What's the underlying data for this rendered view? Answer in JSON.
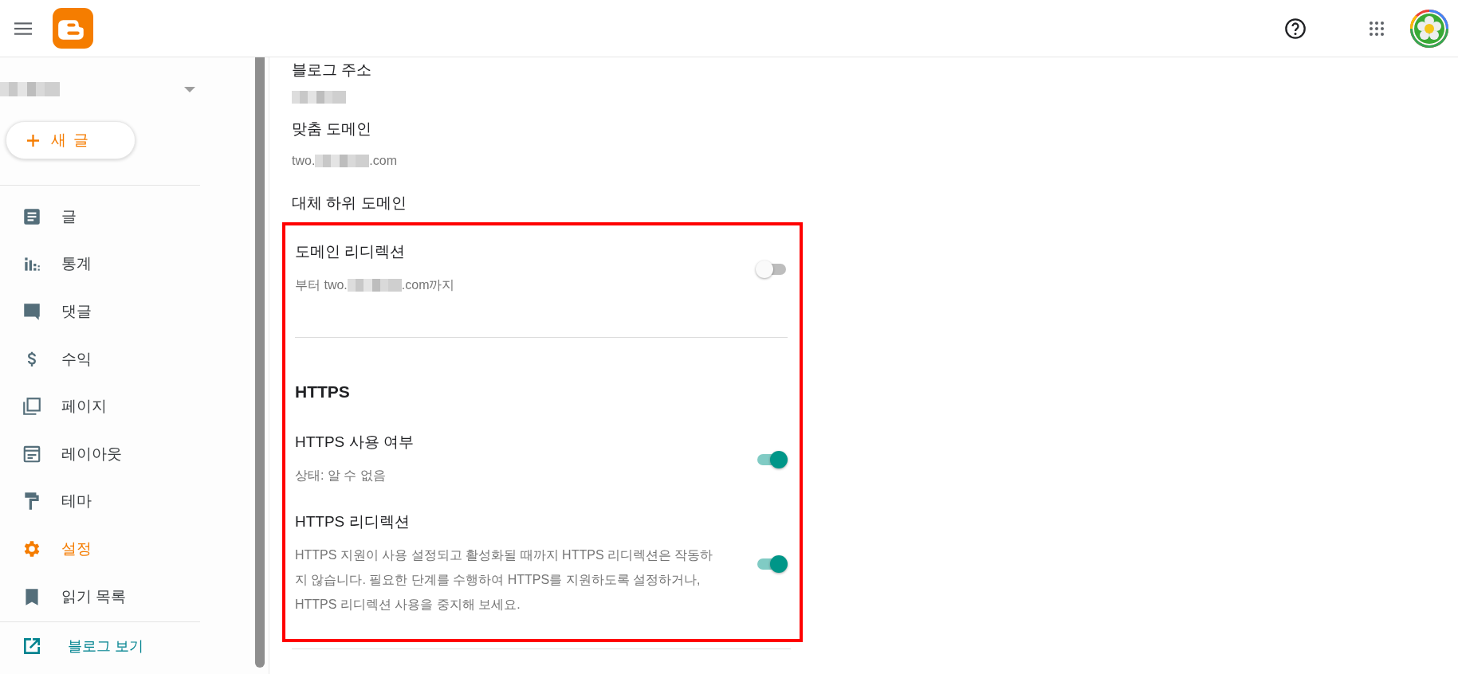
{
  "sidebar": {
    "new_post_button": {
      "label": "새 글"
    },
    "nav_items": [
      {
        "label": "글",
        "selected": false
      },
      {
        "label": "통계",
        "selected": false
      },
      {
        "label": "댓글",
        "selected": false
      },
      {
        "label": "수익",
        "selected": false
      },
      {
        "label": "페이지",
        "selected": false
      },
      {
        "label": "레이아웃",
        "selected": false
      },
      {
        "label": "테마",
        "selected": false
      },
      {
        "label": "설정",
        "selected": true
      },
      {
        "label": "읽기 목록",
        "selected": false
      }
    ],
    "view_blog_link": {
      "label": "블로그 보기"
    }
  },
  "fields": [
    {
      "title": "블로그 주소",
      "value_parts": [
        {
          "kind": "redacted"
        }
      ]
    },
    {
      "title": "맞춤 도메인",
      "value_parts": [
        {
          "kind": "text",
          "text": "two."
        },
        {
          "kind": "redacted"
        },
        {
          "kind": "text",
          "text": ".com"
        }
      ]
    },
    {
      "title": "대체 하위 도메인"
    }
  ],
  "highlighted_sections": [
    {
      "toggles": [
        {
          "title": "도메인 리디렉션",
          "description_parts": [
            {
              "kind": "text",
              "text": "부터 two."
            },
            {
              "kind": "redacted"
            },
            {
              "kind": "text",
              "text": ".com까지"
            }
          ],
          "on": false
        }
      ]
    },
    {
      "heading": "HTTPS",
      "toggles": [
        {
          "title": "HTTPS 사용 여부",
          "description_parts": [
            {
              "kind": "text",
              "text": "상태: 알 수 없음"
            }
          ],
          "on": true
        },
        {
          "title": "HTTPS 리디렉션",
          "description_parts": [
            {
              "kind": "text",
              "text": "HTTPS 지원이 사용 설정되고 활성화될 때까지 HTTPS 리디렉션은 작동하지 않습니다. 필요한 단계를 수행하여 HTTPS를 지원하도록 설정하거나, HTTPS 리디렉션 사용을 중지해 보세요."
            }
          ],
          "on": true
        }
      ]
    }
  ]
}
